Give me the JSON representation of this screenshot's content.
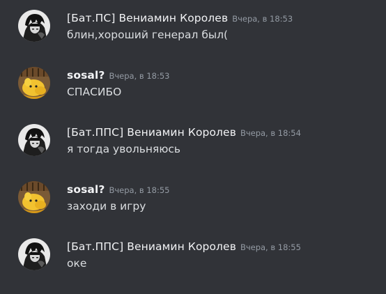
{
  "messages": [
    {
      "author": "[Бат.ПС] Вениамин Королев",
      "timestamp": "Вчера, в 18:53",
      "text": "блин,хороший генерал был(",
      "avatar": "dark-anime-avatar"
    },
    {
      "author": "sosal?",
      "timestamp": "Вчера, в 18:53",
      "text": "СПАСИБО",
      "avatar": "yellow-cartoon-avatar"
    },
    {
      "author": "[Бат.ППС] Вениамин Королев",
      "timestamp": "Вчера, в 18:54",
      "text": "я тогда увольняюсь",
      "avatar": "dark-anime-avatar"
    },
    {
      "author": "sosal?",
      "timestamp": "Вчера, в 18:55",
      "text": "заходи в игру",
      "avatar": "yellow-cartoon-avatar"
    },
    {
      "author": "[Бат.ППС] Вениамин Королев",
      "timestamp": "Вчера, в 18:55",
      "text": "оке",
      "avatar": "dark-anime-avatar"
    }
  ],
  "colors": {
    "background": "#313338",
    "author": "#f2f3f5",
    "timestamp": "#949ba4",
    "text": "#dbdee1"
  }
}
